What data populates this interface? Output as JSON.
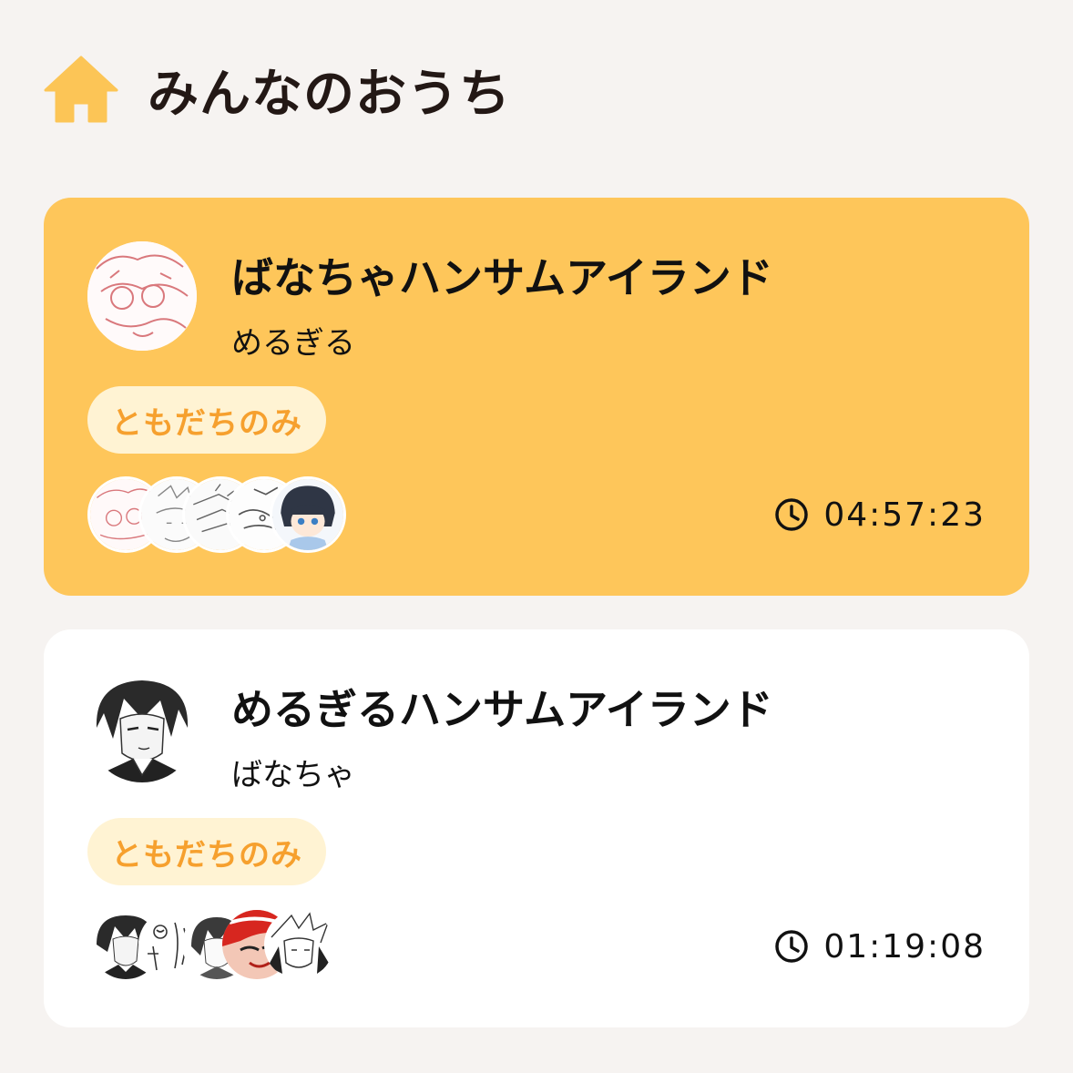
{
  "header": {
    "title": "みんなのおうち",
    "icon": "home-icon",
    "icon_color": "#fcc556"
  },
  "rooms": [
    {
      "title": "ばなちゃハンサムアイランド",
      "owner": "めるぎる",
      "badge": "ともだちのみ",
      "timer": "04:57:23",
      "card_color": "#fec65a",
      "badge_bg": "#fff3d3",
      "badge_color": "#f6a02e",
      "member_count": 5
    },
    {
      "title": "めるぎるハンサムアイランド",
      "owner": "ばなちゃ",
      "badge": "ともだちのみ",
      "timer": "01:19:08",
      "card_color": "#ffffff",
      "badge_bg": "#fff3d3",
      "badge_color": "#f6a02e",
      "member_count": 5
    }
  ]
}
